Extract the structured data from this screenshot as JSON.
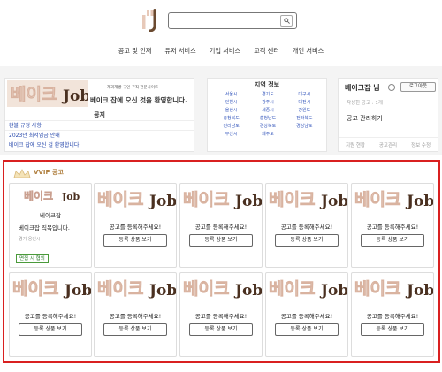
{
  "search": {
    "value": "",
    "placeholder": ""
  },
  "nav": [
    "공고 및 인재",
    "유저 서비스",
    "기업 서비스",
    "고객 센터",
    "개인 서비스"
  ],
  "promo": {
    "tagline": "제과제빵 구인 구직 전문사이트",
    "welcome": "베이크 잡에 오신 것을 환영합니다.",
    "notice_title": "공지",
    "notices": [
      "환불 규정 사항",
      "2023년 최저임금 안내",
      "베이크 잡에 오신 걸 환영합니다."
    ]
  },
  "region": {
    "title": "지역 정보",
    "cities": [
      "서울시",
      "경기도",
      "대구시",
      "인천시",
      "광주시",
      "대전시",
      "울산시",
      "세종시",
      "강원도",
      "충청북도",
      "충청남도",
      "전라북도",
      "전라남도",
      "경상북도",
      "경상남도",
      "부산시",
      "제주도"
    ]
  },
  "user": {
    "name": "베이크잡 님",
    "logout_label": "로그아웃",
    "viewed": "작성한 공고 : 1개",
    "manage": "공고 관리하기",
    "links": [
      "지원 현황",
      "공고관리",
      "정보 수정"
    ]
  },
  "vvip": {
    "title": "VVIP 공고",
    "first_card": {
      "company": "베이크잡",
      "job": "베이크잡 직목입니다.",
      "location": "경기 용인시",
      "badge": "면접 시 협의"
    },
    "placeholder_text": "공고를 등록해주세요!",
    "button_label": "등록 상품 보기"
  },
  "colors": {
    "brand_brown": "#8c5a35",
    "brand_pink": "#e7c9b9",
    "highlight_red": "#d92020",
    "accent_gold": "#b08040"
  }
}
